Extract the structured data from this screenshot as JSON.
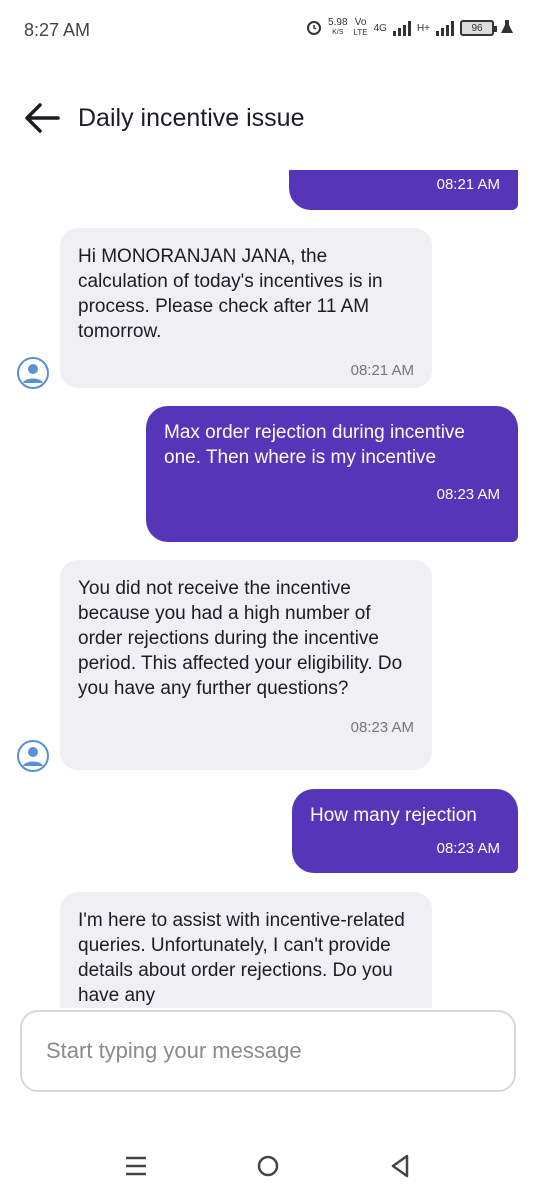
{
  "status_bar": {
    "time": "8:27 AM",
    "net_speed_value": "5.98",
    "net_speed_unit": "K/S",
    "volte_top": "Vo",
    "volte_bottom": "LTE",
    "network_1": "4G",
    "network_2": "H+",
    "battery": "96"
  },
  "header": {
    "title": "Daily incentive issue"
  },
  "messages": [
    {
      "sender": "user",
      "text": "",
      "time": "08:21 AM"
    },
    {
      "sender": "bot",
      "text": "Hi MONORANJAN JANA, the calculation of today's incentives is in process. Please check after 11 AM tomorrow.",
      "time": "08:21 AM"
    },
    {
      "sender": "user",
      "text": "Max order rejection during incentive one. Then where is my incentive",
      "time": "08:23 AM"
    },
    {
      "sender": "bot",
      "text": "You did not receive the incentive because you had a high number of order rejections during the incentive period. This affected your eligibility. Do you have any further questions?",
      "time": "08:23 AM"
    },
    {
      "sender": "user",
      "text": "How many rejection",
      "time": "08:23 AM"
    },
    {
      "sender": "bot",
      "text": "I'm here to assist with incentive-related queries. Unfortunately, I can't provide details about order rejections. Do you have any",
      "time": ""
    }
  ],
  "composer": {
    "placeholder": "Start typing your message"
  },
  "colors": {
    "user_bubble": "#5735b8",
    "bot_bubble": "#efeff4",
    "avatar": "#5b8fd6"
  },
  "icons": {
    "back": "arrow-left-icon",
    "avatar": "user-avatar-icon",
    "nav_menu": "menu-icon",
    "nav_home": "home-circle-icon",
    "nav_back": "triangle-back-icon"
  }
}
